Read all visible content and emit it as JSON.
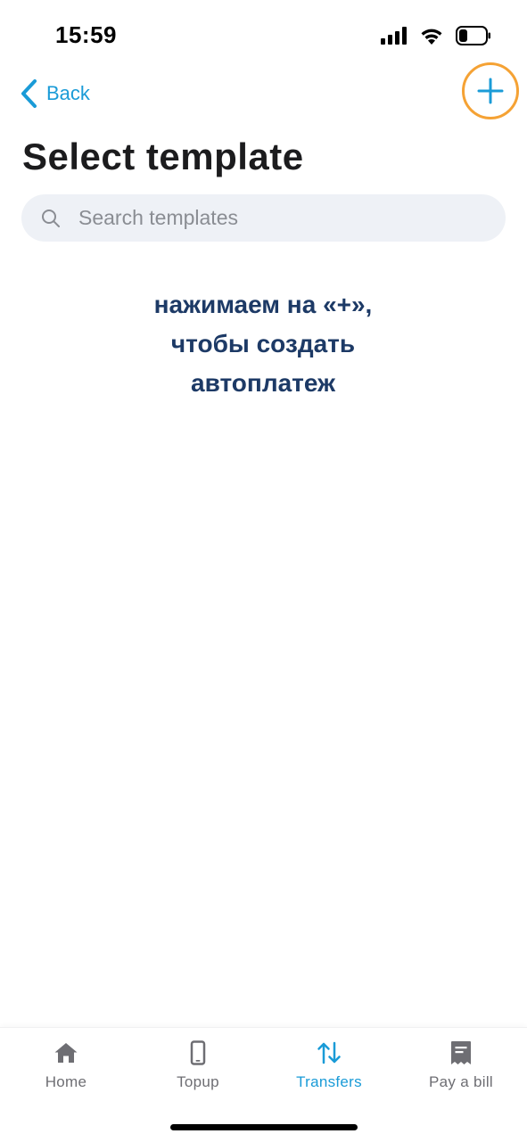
{
  "status_bar": {
    "time": "15:59",
    "icons": [
      "cellular-signal-icon",
      "wifi-icon",
      "battery-icon"
    ]
  },
  "nav": {
    "back_label": "Back",
    "back_icon": "chevron-left-icon",
    "add_icon": "plus-icon",
    "add_highlight_color": "#f5a234"
  },
  "title": "Select template",
  "search": {
    "placeholder": "Search templates",
    "value": "",
    "icon": "search-icon"
  },
  "hint": {
    "lines": [
      "нажимаем на «+»,",
      "чтобы создать",
      "автоплатеж"
    ]
  },
  "tabs": [
    {
      "label": "Home",
      "icon": "home-icon",
      "active": false
    },
    {
      "label": "Topup",
      "icon": "phone-icon",
      "active": false
    },
    {
      "label": "Transfers",
      "icon": "transfer-arrows-icon",
      "active": true
    },
    {
      "label": "Pay a bill",
      "icon": "bill-icon",
      "active": false
    }
  ],
  "colors": {
    "accent": "#1a9bd7",
    "hint_text": "#1d3a66",
    "search_bg": "#eef1f6",
    "inactive_tab": "#6e6e73"
  }
}
